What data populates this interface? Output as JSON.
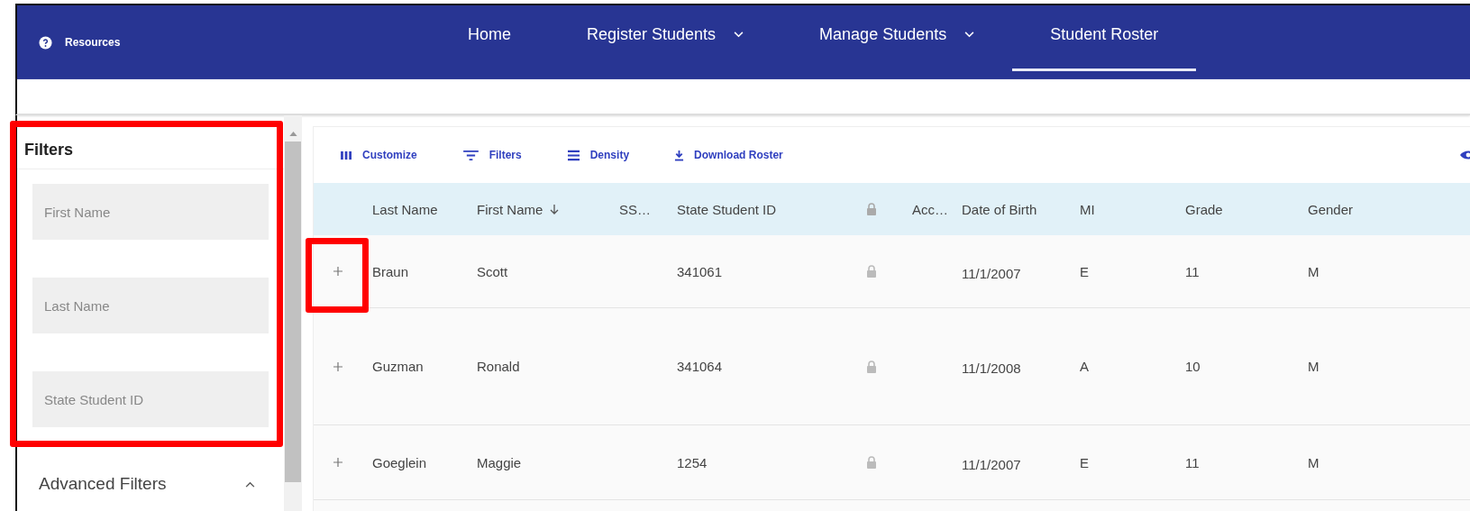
{
  "nav": {
    "resources": "Resources",
    "items": [
      {
        "label": "Home",
        "dropdown": false,
        "selected": false
      },
      {
        "label": "Register Students",
        "dropdown": true,
        "selected": false
      },
      {
        "label": "Manage Students",
        "dropdown": true,
        "selected": false
      },
      {
        "label": "Student Roster",
        "dropdown": false,
        "selected": true
      }
    ]
  },
  "filters": {
    "title": "Filters",
    "fields": [
      {
        "placeholder": "First Name"
      },
      {
        "placeholder": "Last Name"
      },
      {
        "placeholder": "State Student ID"
      }
    ],
    "advanced": {
      "label": "Advanced Filters",
      "expanded": true
    }
  },
  "toolbar": [
    {
      "label": "Customize",
      "kind": "columns"
    },
    {
      "label": "Filters",
      "kind": "filter"
    },
    {
      "label": "Density",
      "kind": "density"
    },
    {
      "label": "Download Roster",
      "kind": "download"
    }
  ],
  "table": {
    "columns": [
      {
        "kind": "expand"
      },
      {
        "kind": "text",
        "label": "Last Name",
        "sorted": false
      },
      {
        "kind": "text",
        "label": "First Name",
        "sorted": true
      },
      {
        "kind": "text",
        "label": "SS…",
        "sorted": false
      },
      {
        "kind": "text",
        "label": "State Student ID",
        "sorted": false
      },
      {
        "kind": "lock"
      },
      {
        "kind": "text",
        "label": "Acc…",
        "sorted": false
      },
      {
        "kind": "text",
        "label": "Date of Birth",
        "sorted": false
      },
      {
        "kind": "text",
        "label": "MI",
        "sorted": false
      },
      {
        "kind": "text",
        "label": "Grade",
        "sorted": false
      },
      {
        "kind": "text",
        "label": "Gender",
        "sorted": false
      }
    ],
    "rows": [
      {
        "cells": [
          "",
          "Braun",
          "Scott",
          "",
          "341061",
          "",
          "",
          "11/1/2007",
          "E",
          "11",
          "M"
        ]
      },
      {
        "cells": [
          "",
          "Guzman",
          "Ronald",
          "",
          "341064",
          "",
          "",
          "11/1/2008",
          "A",
          "10",
          "M"
        ]
      },
      {
        "cells": [
          "",
          "Goeglein",
          "Maggie",
          "",
          "1254",
          "",
          "",
          "11/1/2007",
          "E",
          "11",
          "M"
        ]
      }
    ]
  }
}
